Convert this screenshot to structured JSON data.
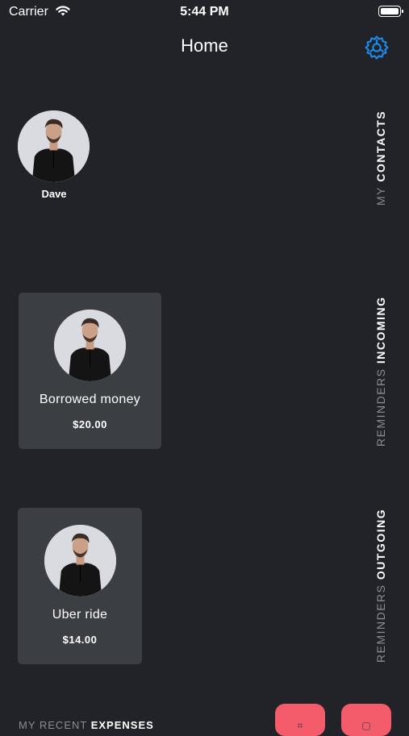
{
  "status": {
    "carrier": "Carrier",
    "time": "5:44 PM"
  },
  "nav": {
    "title": "Home",
    "settings_icon": "gear-icon",
    "accent": "#1e88e5"
  },
  "sections": {
    "contacts": {
      "prefix": "MY",
      "label": "CONTACTS"
    },
    "incoming": {
      "prefix": "REMINDERS",
      "label": "INCOMING"
    },
    "outgoing": {
      "prefix": "REMINDERS",
      "label": "OUTGOING"
    },
    "expenses": {
      "prefix": "MY RECENT",
      "label": "EXPENSES"
    }
  },
  "contacts": [
    {
      "name": "Dave"
    }
  ],
  "incoming": [
    {
      "title": "Borrowed money",
      "amount": "$20.00"
    }
  ],
  "outgoing": [
    {
      "title": "Uber ride",
      "amount": "$14.00"
    }
  ],
  "colors": {
    "background": "#212328",
    "card": "#3b3e43",
    "fab": "#f45b6b"
  }
}
